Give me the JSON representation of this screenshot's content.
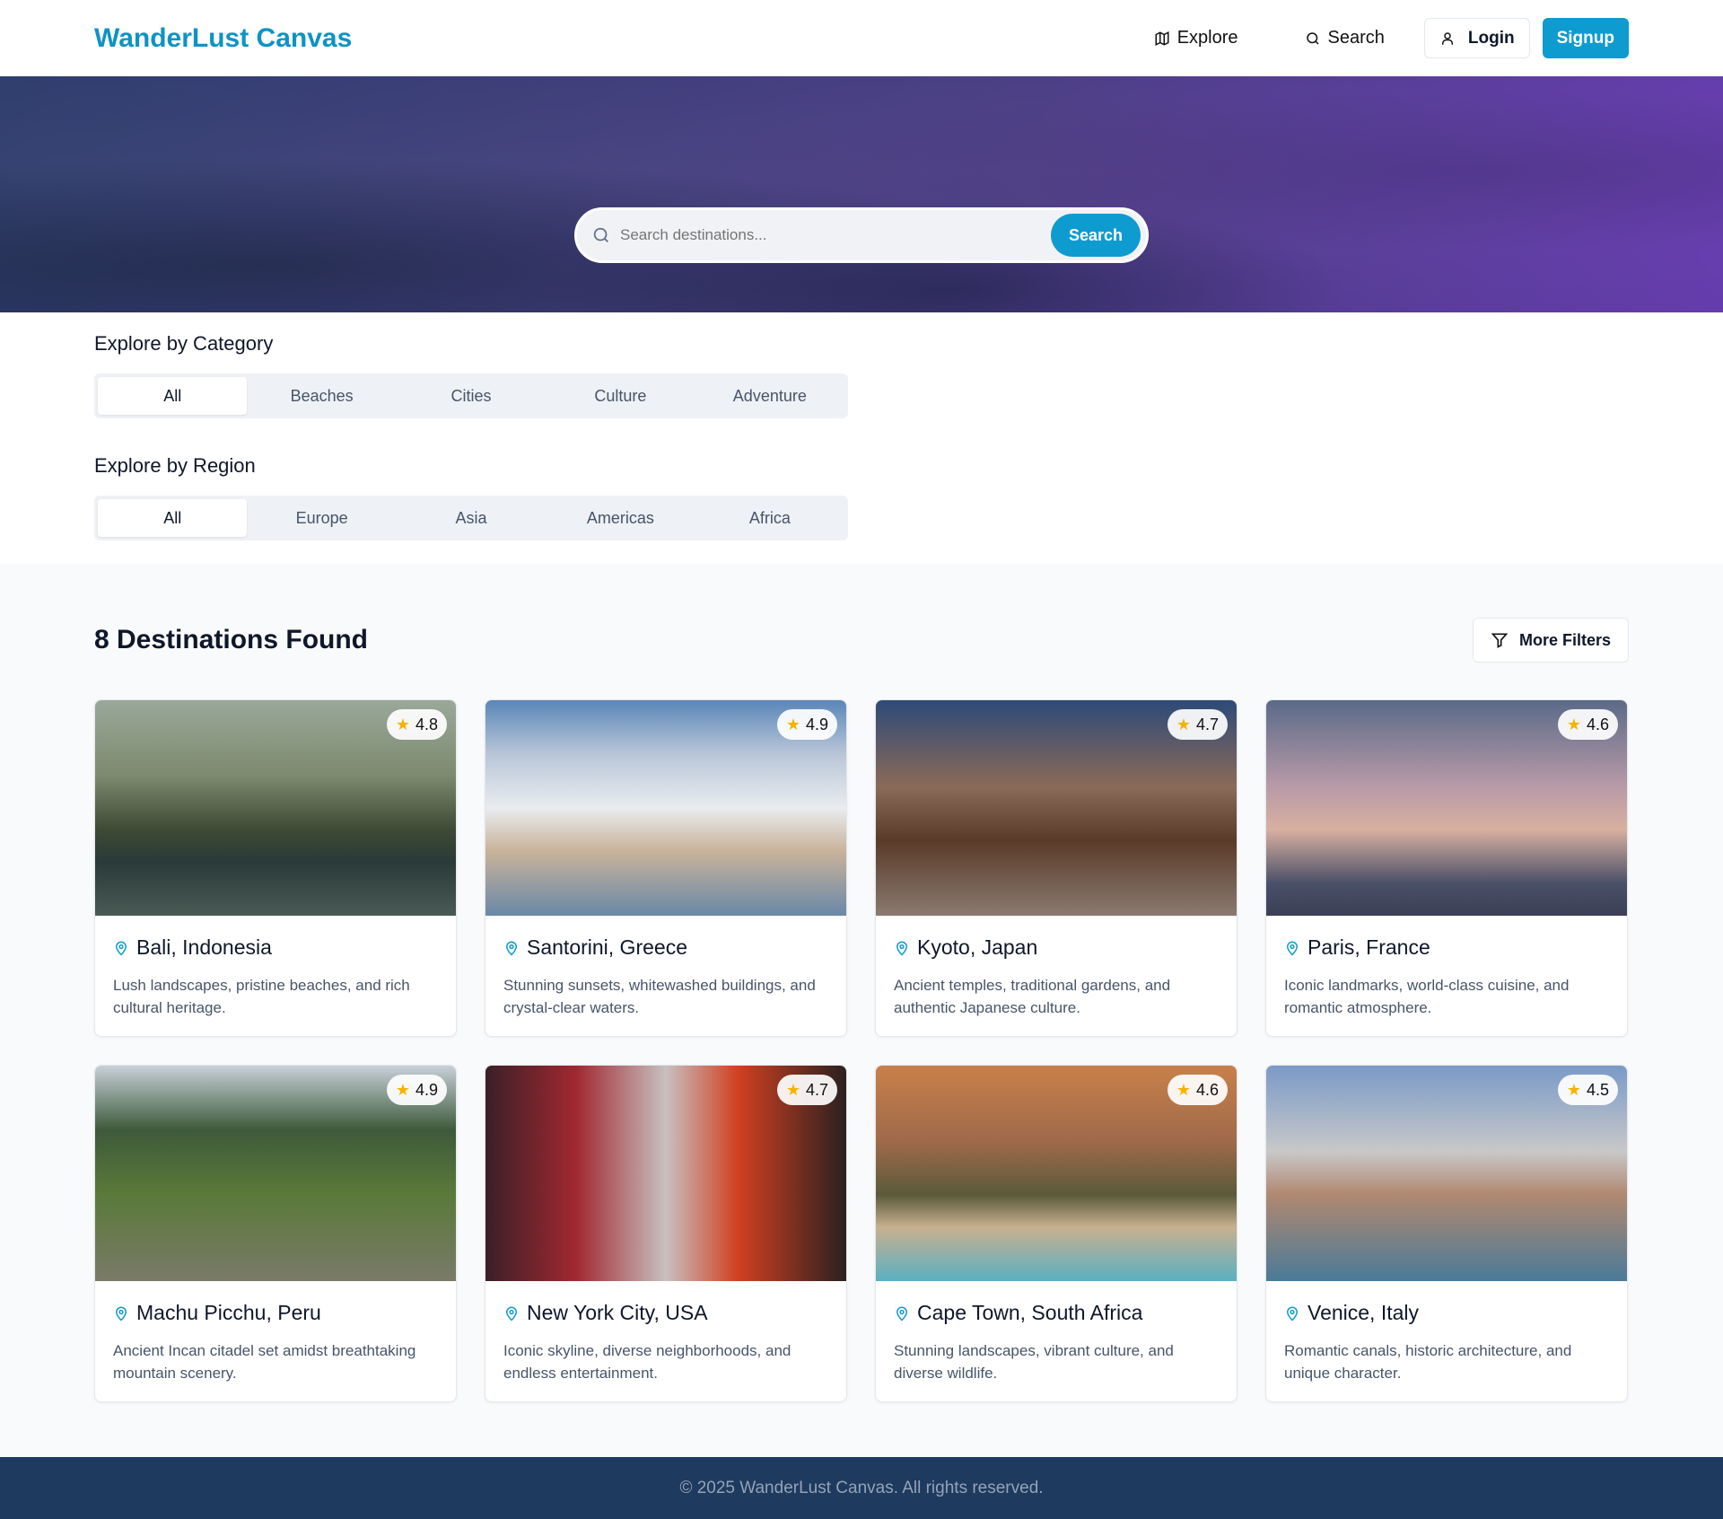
{
  "header": {
    "logo": "WanderLust Canvas",
    "explore": "Explore",
    "search": "Search",
    "login": "Login",
    "signup": "Signup"
  },
  "hero": {
    "title": "Explore Destinations",
    "placeholder": "Search destinations...",
    "button": "Search"
  },
  "category": {
    "heading": "Explore by Category",
    "tabs": [
      "All",
      "Beaches",
      "Cities",
      "Culture",
      "Adventure"
    ]
  },
  "region": {
    "heading": "Explore by Region",
    "tabs": [
      "All",
      "Europe",
      "Asia",
      "Americas",
      "Africa"
    ]
  },
  "results": {
    "count_label": "8 Destinations Found",
    "more_filters": "More Filters",
    "cards": [
      {
        "name": "Bali, Indonesia",
        "rating": "4.8",
        "desc": "Lush landscapes, pristine beaches, and rich cultural heritage."
      },
      {
        "name": "Santorini, Greece",
        "rating": "4.9",
        "desc": "Stunning sunsets, whitewashed buildings, and crystal-clear waters."
      },
      {
        "name": "Kyoto, Japan",
        "rating": "4.7",
        "desc": "Ancient temples, traditional gardens, and authentic Japanese culture."
      },
      {
        "name": "Paris, France",
        "rating": "4.6",
        "desc": "Iconic landmarks, world-class cuisine, and romantic atmosphere."
      },
      {
        "name": "Machu Picchu, Peru",
        "rating": "4.9",
        "desc": "Ancient Incan citadel set amidst breathtaking mountain scenery."
      },
      {
        "name": "New York City, USA",
        "rating": "4.7",
        "desc": "Iconic skyline, diverse neighborhoods, and endless entertainment."
      },
      {
        "name": "Cape Town, South Africa",
        "rating": "4.6",
        "desc": "Stunning landscapes, vibrant culture, and diverse wildlife."
      },
      {
        "name": "Venice, Italy",
        "rating": "4.5",
        "desc": "Romantic canals, historic architecture, and unique character."
      }
    ]
  },
  "footer": {
    "text": "© 2025 WanderLust Canvas. All rights reserved."
  },
  "colors": {
    "accent": "#0e9bd0",
    "footer": "#1e3a5f"
  }
}
